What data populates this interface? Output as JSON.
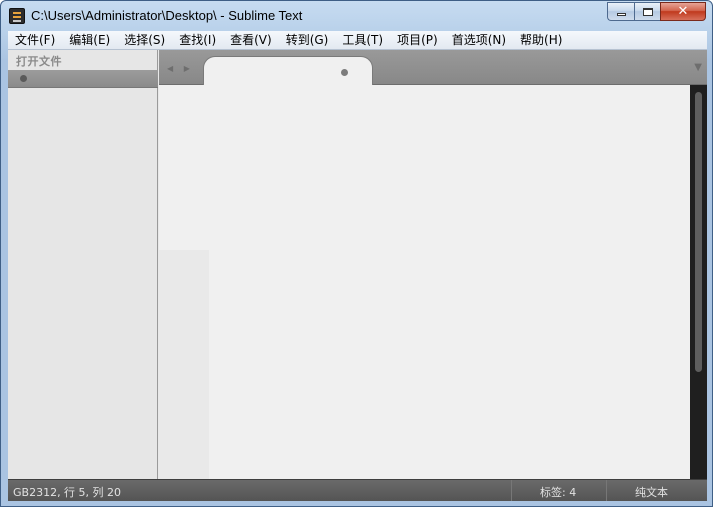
{
  "window": {
    "title": "C:\\Users\\Administrator\\Desktop\\ - Sublime Text",
    "buttons": {
      "minimize": "minimize",
      "maximize": "maximize",
      "close": "✕"
    }
  },
  "menu": {
    "items": [
      "文件(F)",
      "编辑(E)",
      "选择(S)",
      "查找(I)",
      "查看(V)",
      "转到(G)",
      "工具(T)",
      "项目(P)",
      "首选项(N)",
      "帮助(H)"
    ]
  },
  "sidebar": {
    "header": "打开文件"
  },
  "tabs": {
    "nav_arrows": "◀ ▶",
    "dropdown": "▼"
  },
  "statusbar": {
    "encoding_position": "GB2312, 行 5, 列 20",
    "tab_size": "标签: 4",
    "syntax": "纯文本"
  },
  "colors": {
    "titlebar": "#b9d1ea",
    "editor_bg": "#f0f0f0",
    "tabbar_bg": "#8f8f8f",
    "statusbar_bg": "#5a5a5a",
    "sidebar_bg": "#e6e6e6",
    "close_button": "#c0391d"
  },
  "icons": {
    "app": "sublime-text-icon",
    "minimize": "minimize-icon",
    "maximize": "maximize-icon",
    "close": "close-icon",
    "modified_dot": "dirty-dot-icon"
  }
}
